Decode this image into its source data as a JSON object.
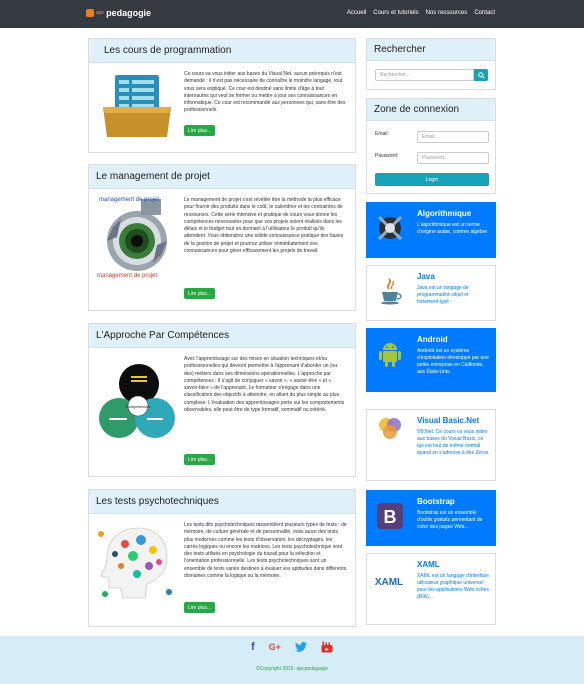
{
  "navbar": {
    "brand_prefix": "apc",
    "brand": "pedagogie",
    "links": [
      "Accueil",
      "Cours et tutoriels",
      "Nos ressources",
      "Contact"
    ]
  },
  "cards": [
    {
      "title": "Les cours de programmation",
      "text": "Ce cours va vous initier aux bases du Visual Net. aucun prérequis n'est demandé : il n'est pas nécessaire de connaître le moindre langage, tout vous sera expliqué. Ce cour est destiné sans limite d'âge à tout internautes qui veut se former ou mettre à jour ses connaissances en informatique. Ce cour est recommandé aux personnes qui, sans être des professionnels.",
      "button": "Lire plus..."
    },
    {
      "title": "Le management de projet",
      "image_caption": "management de projet",
      "text": "Le management de projet s'est révélée être la méthode la plus efficace pour fournir des produits dans le coût, le calendrier et les contraintes de ressources. Cette série intensive et pratique de cours vous donne les compétences nécessaires pour que vos projets soient réalisés dans les délais et le budget tout en donnant à l'utilisateur le produit qu'ils attendent. Vous obtiendrez une solide connaissance pratique des bases de la gestion de projet et pourrez utiliser immédiatement ces connaissances pour gérer efficacement les projets de travail.",
      "button": "Lire plus..."
    },
    {
      "title": "L'Approche Par Compétences",
      "image_center_label": "Compétences",
      "text": "Avec l'apprentissage sur des mises en situation techniques et/ou professionnelles qui devront permettre à l'apprenant d'aborder un (ou des) métiers dans ses dimensions opérationnelles. L'approche par compétences : Il s'agit de conjuguer « savoir », « savoir-être » et « savoir-faire » de l'apprenant. Le formateur s'engage dans une classification des objectifs à atteindre, en allant du plus simple au plus complexe. L'évaluation des apprentissages porte sur les comportements observables, elle peut être de type formatif, sommatif ou critérié.",
      "button": "Lire plus..."
    },
    {
      "title": "Les tests psychotechniques",
      "text": "Les tests dits psychotechniques rassemblent plusieurs types de tests : de mémoire, de culture générale et de personnalité, mais aussi des tests plus modernes comme les tests d'observation, les décryptages, les carrés logiques ou encore les matrices. Les tests psychotechnique sont des tests utilisés en psychologie du travail pour la sélection et l'orientation professionnelle. Les tests psychotechniques sont un ensemble de tests variés destinés à évaluer vos aptitudes dans différents domaines comme la logique ou la mémoire.",
      "button": "Lire plus..."
    }
  ],
  "search": {
    "title": "Rechercher",
    "placeholder": "Rechercher..."
  },
  "login": {
    "title": "Zone de connexion",
    "email_label": "Email:",
    "email_placeholder": "Email...",
    "password_label": "Password:",
    "password_placeholder": "Password...",
    "button": "Login"
  },
  "techs": [
    {
      "title": "Algorithmique",
      "desc": "L'algorithmique est un terme d'origine arabe, comme algèbre",
      "style": "blue",
      "icon": "algorithm-icon"
    },
    {
      "title": "Java",
      "desc": "Java est un langage de programmation objet et fortement typé :",
      "style": "white",
      "icon": "java-icon"
    },
    {
      "title": "Android",
      "desc": "Android est un système d'exploitation développé par une petite entreprise en Californie, aux États-Unis.",
      "style": "blue",
      "icon": "android-icon"
    },
    {
      "title": "Visual Basic.Net",
      "desc": "VB.Net: Ce cours va vous initier aux bases du Visual Basic, ce qui est tout de même normal quand on s'adresse à des Zéros.",
      "style": "white",
      "icon": "vb-icon"
    },
    {
      "title": "Bootstrap",
      "desc": "Bootstrap est un ensemble d'outils gratuits permettant de créer des pages Web...",
      "style": "blue",
      "icon": "bootstrap-icon",
      "icon_text": "B"
    },
    {
      "title": "XAML",
      "desc": "XAML est un langage d'interface utilisateur graphique universel pour les applications Web riches (RIA)...",
      "style": "white",
      "icon": "xaml-icon",
      "icon_text": "XAML"
    }
  ],
  "footer": {
    "social": [
      {
        "icon": "facebook-icon",
        "glyph": "f",
        "color": "#3b5998"
      },
      {
        "icon": "google-plus-icon",
        "glyph": "G+",
        "color": "#dd4b39"
      },
      {
        "icon": "twitter-icon",
        "glyph": "🐦",
        "color": "#1da1f2"
      },
      {
        "icon": "youtube-icon",
        "glyph": "▶",
        "color": "#e52d27"
      }
    ],
    "copyright": "©Copyright 2016 -apcpedagogie"
  },
  "colors": {
    "navbar": "#343a40",
    "card_header": "#dff0f8",
    "green": "#28a745",
    "teal": "#17a2b8",
    "blue": "#007bff",
    "footer": "#d6ecf6"
  }
}
